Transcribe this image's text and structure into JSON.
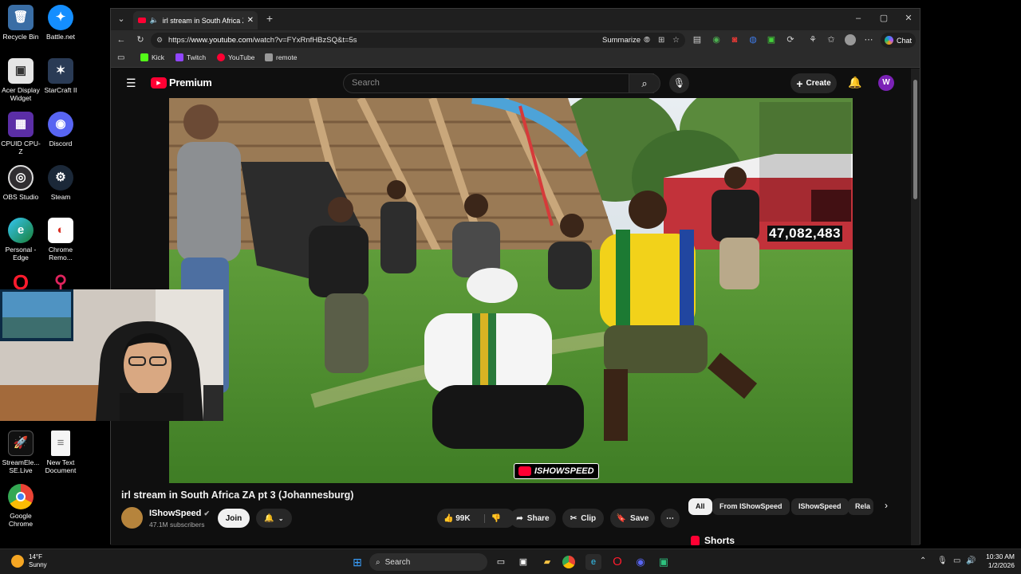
{
  "desktop": {
    "icons": [
      {
        "label": "Recycle Bin"
      },
      {
        "label": "Battle.net"
      },
      {
        "label": "Acer Display Widget"
      },
      {
        "label": "StarCraft II"
      },
      {
        "label": "CPUID CPU-Z"
      },
      {
        "label": "Discord"
      },
      {
        "label": "OBS Studio"
      },
      {
        "label": "Steam"
      },
      {
        "label": "Personal - Edge"
      },
      {
        "label": "Chrome Remo..."
      },
      {
        "label": "StreamEle... SE.Live"
      },
      {
        "label": "New Text Document"
      },
      {
        "label": "Google Chrome"
      }
    ]
  },
  "browser": {
    "tab_title": "irl stream in South Africa ZA pt",
    "url_prefix": "https://",
    "url_domain": "www.youtube.com",
    "url_rest": "/watch?v=FYxRnfHBzSQ&t=5s",
    "summarize_label": "Summarize",
    "chat_label": "Chat",
    "favorites": [
      {
        "label": "Kick",
        "color": "#53fc18"
      },
      {
        "label": "Twitch",
        "color": "#9146ff"
      },
      {
        "label": "YouTube",
        "color": "#ff0033"
      },
      {
        "label": "remote",
        "color": "#999999"
      }
    ]
  },
  "youtube": {
    "logo_label": "Premium",
    "search_placeholder": "Search",
    "create_label": "Create",
    "avatar_letter": "W",
    "video": {
      "view_count_overlay": "47,082,483",
      "watermark": "ISHOWSPEED",
      "title": "irl stream in South Africa ZA pt 3 (Johannesburg)",
      "channel_name": "IShowSpeed",
      "subscribers": "47.1M subscribers",
      "join_label": "Join",
      "likes": "99K",
      "share_label": "Share",
      "clip_label": "Clip",
      "save_label": "Save"
    },
    "chips": [
      {
        "label": "All"
      },
      {
        "label": "From IShowSpeed"
      },
      {
        "label": "IShowSpeed"
      },
      {
        "label": "Rela"
      }
    ],
    "shorts_label": "Shorts"
  },
  "taskbar": {
    "weather_temp": "14°F",
    "weather_desc": "Sunny",
    "search_label": "Search",
    "time": "10:30 AM",
    "date": "1/2/2026"
  },
  "colors": {
    "yt_red": "#ff0033",
    "yt_bg": "#0f0f0f"
  }
}
